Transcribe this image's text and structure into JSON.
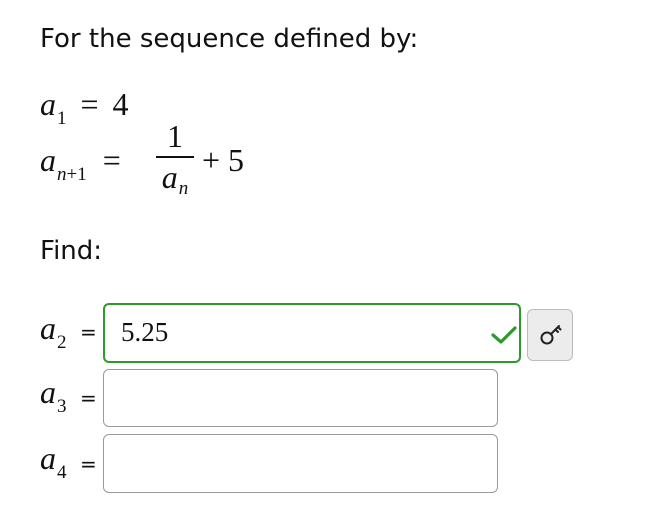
{
  "problem": {
    "heading": "For the sequence defined by:",
    "initial": {
      "var": "a",
      "sub": "1",
      "eq": "=",
      "value": "4"
    },
    "recurrence": {
      "var": "a",
      "sub_var": "n",
      "sub_plus": "+1",
      "eq": "=",
      "numerator": "1",
      "denominator_var": "a",
      "denominator_sub": "n",
      "tail": "+ 5"
    },
    "find_label": "Find:"
  },
  "answers": [
    {
      "var": "a",
      "sub": "2",
      "eq": "=",
      "value": "5.25",
      "status": "correct",
      "placeholder": ""
    },
    {
      "var": "a",
      "sub": "3",
      "eq": "=",
      "value": "",
      "status": "empty",
      "placeholder": ""
    },
    {
      "var": "a",
      "sub": "4",
      "eq": "=",
      "value": "",
      "status": "empty",
      "placeholder": ""
    }
  ],
  "icons": {
    "correct": "checkmark-icon",
    "key": "key-icon"
  },
  "colors": {
    "correct_green": "#2e9a2e",
    "field_border": "#9a9a9a",
    "key_button_bg": "#ececec"
  }
}
